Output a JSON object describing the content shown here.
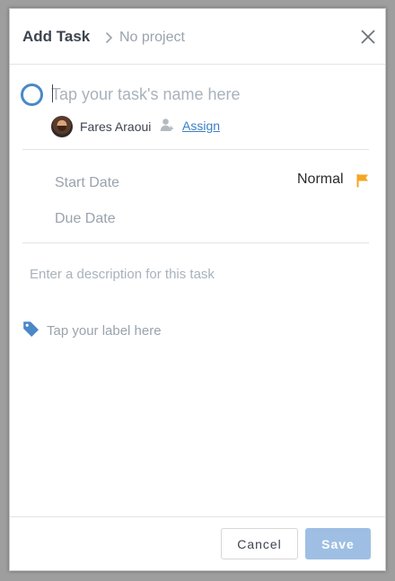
{
  "header": {
    "title": "Add Task",
    "project": "No project"
  },
  "task": {
    "name_placeholder": "Tap your task's name here",
    "name_value": ""
  },
  "assignee": {
    "name": "Fares Araoui",
    "assign_label": "Assign"
  },
  "dates": {
    "start_label": "Start Date",
    "due_label": "Due Date"
  },
  "priority": {
    "label": "Normal",
    "flag_color": "#f5a623"
  },
  "description": {
    "placeholder": "Enter a description for this task",
    "value": ""
  },
  "label": {
    "placeholder": "Tap your label here",
    "value": ""
  },
  "footer": {
    "cancel_label": "Cancel",
    "save_label": "Save"
  },
  "colors": {
    "accent": "#4a88c7",
    "link": "#3b7fc4",
    "save_disabled": "#9ebfe3"
  },
  "icons": {
    "header_separator": "chevron-right-icon",
    "close": "close-icon",
    "status": "task-circle-icon",
    "assign": "add-person-icon",
    "priority": "flag-icon",
    "label": "tag-icon"
  }
}
